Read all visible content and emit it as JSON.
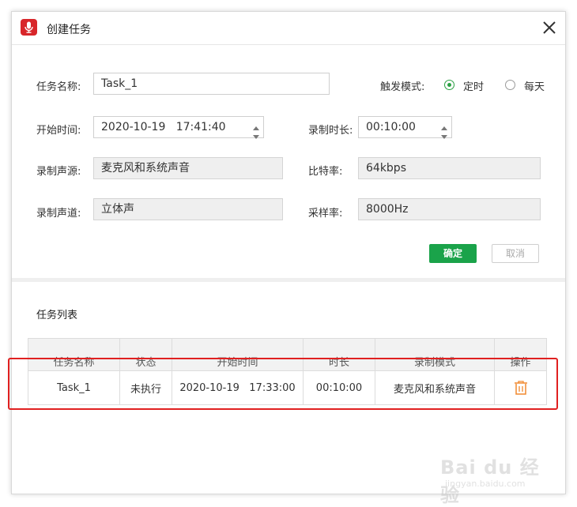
{
  "window": {
    "title": "创建任务",
    "icon": "microphone-icon",
    "close_icon": "close-icon"
  },
  "form": {
    "task_name": {
      "label": "任务名称:",
      "value": "Task_1"
    },
    "trigger_mode": {
      "label": "触发模式:",
      "options": [
        {
          "label": "定时",
          "checked": true
        },
        {
          "label": "每天",
          "checked": false
        }
      ]
    },
    "start_time": {
      "label": "开始时间:",
      "value": "2020-10-19   17:41:40"
    },
    "duration": {
      "label": "录制时长:",
      "value": "00:10:00"
    },
    "source": {
      "label": "录制声源:",
      "value": "麦克风和系统声音"
    },
    "bitrate": {
      "label": "比特率:",
      "value": "64kbps"
    },
    "channel": {
      "label": "录制声道:",
      "value": "立体声"
    },
    "sample_rate": {
      "label": "采样率:",
      "value": "8000Hz"
    },
    "confirm_label": "确定",
    "cancel_label": "取消"
  },
  "task_list": {
    "title": "任务列表",
    "columns": [
      "任务名称",
      "状态",
      "开始时间",
      "时长",
      "录制模式",
      "操作"
    ],
    "rows": [
      {
        "name": "Task_1",
        "status": "未执行",
        "start": "2020-10-19   17:33:00",
        "duration": "00:10:00",
        "mode": "麦克风和系统声音",
        "action": "trash-icon"
      }
    ]
  },
  "colors": {
    "accent_green": "#1aa34a",
    "app_red": "#d8262a",
    "highlight_red": "#e02020",
    "trash_orange": "#f0892e"
  },
  "watermark": {
    "brand": "Bai du 经验",
    "url": "jingyan.baidu.com"
  }
}
